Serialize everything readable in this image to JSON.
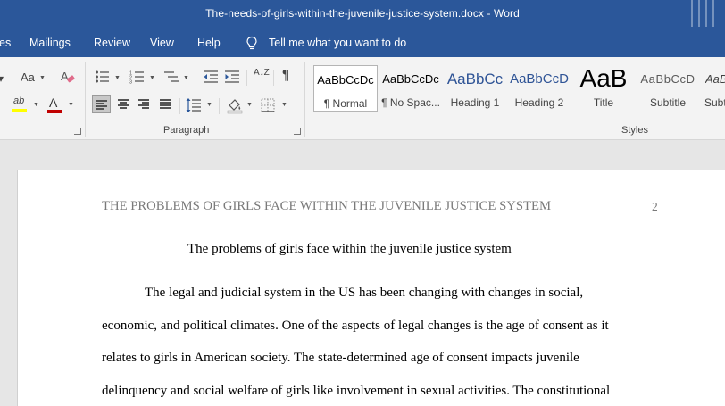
{
  "window": {
    "title": "The-needs-of-girls-within-the-juvenile-justice-system.docx  -  Word"
  },
  "menu": {
    "items": [
      "es",
      "Mailings",
      "Review",
      "View",
      "Help"
    ],
    "tell_me": "Tell me what you want to do"
  },
  "ribbon": {
    "font_group": {
      "change_case": "Aa",
      "highlight_label": "ab",
      "font_color_label": "A",
      "font_color": "#c00000",
      "highlight_color": "#ffff00"
    },
    "paragraph_group": {
      "label": "Paragraph",
      "pilcrow": "¶",
      "sort": "A↓Z"
    },
    "styles_group": {
      "label": "Styles",
      "tiles": [
        {
          "preview": "AaBbCcDc",
          "name": "¶ Normal"
        },
        {
          "preview": "AaBbCcDc",
          "name": "¶ No Spac..."
        },
        {
          "preview": "AaBbCc",
          "name": "Heading 1"
        },
        {
          "preview": "AaBbCcD",
          "name": "Heading 2"
        },
        {
          "preview": "AaB",
          "name": "Title"
        },
        {
          "preview": "AaBbCcD",
          "name": "Subtitle"
        },
        {
          "preview": "AaBl",
          "name": "Subt"
        }
      ]
    }
  },
  "document": {
    "running_header": "THE PROBLEMS OF GIRLS FACE WITHIN THE JUVENILE JUSTICE SYSTEM",
    "page_number": "2",
    "title": "The problems of girls face within the juvenile justice system",
    "body_lines": [
      "The legal and judicial system in the US has been changing with changes in social,",
      "economic, and political climates. One of the aspects of legal changes is the age of consent as it",
      "relates to girls in American society. The state-determined age of consent impacts juvenile",
      "delinquency and social welfare of girls like involvement in sexual activities. The constitutional"
    ]
  },
  "colors": {
    "word_blue": "#2b579a",
    "ribbon_bg": "#f3f3f3",
    "heading_blue": "#2f5496"
  }
}
